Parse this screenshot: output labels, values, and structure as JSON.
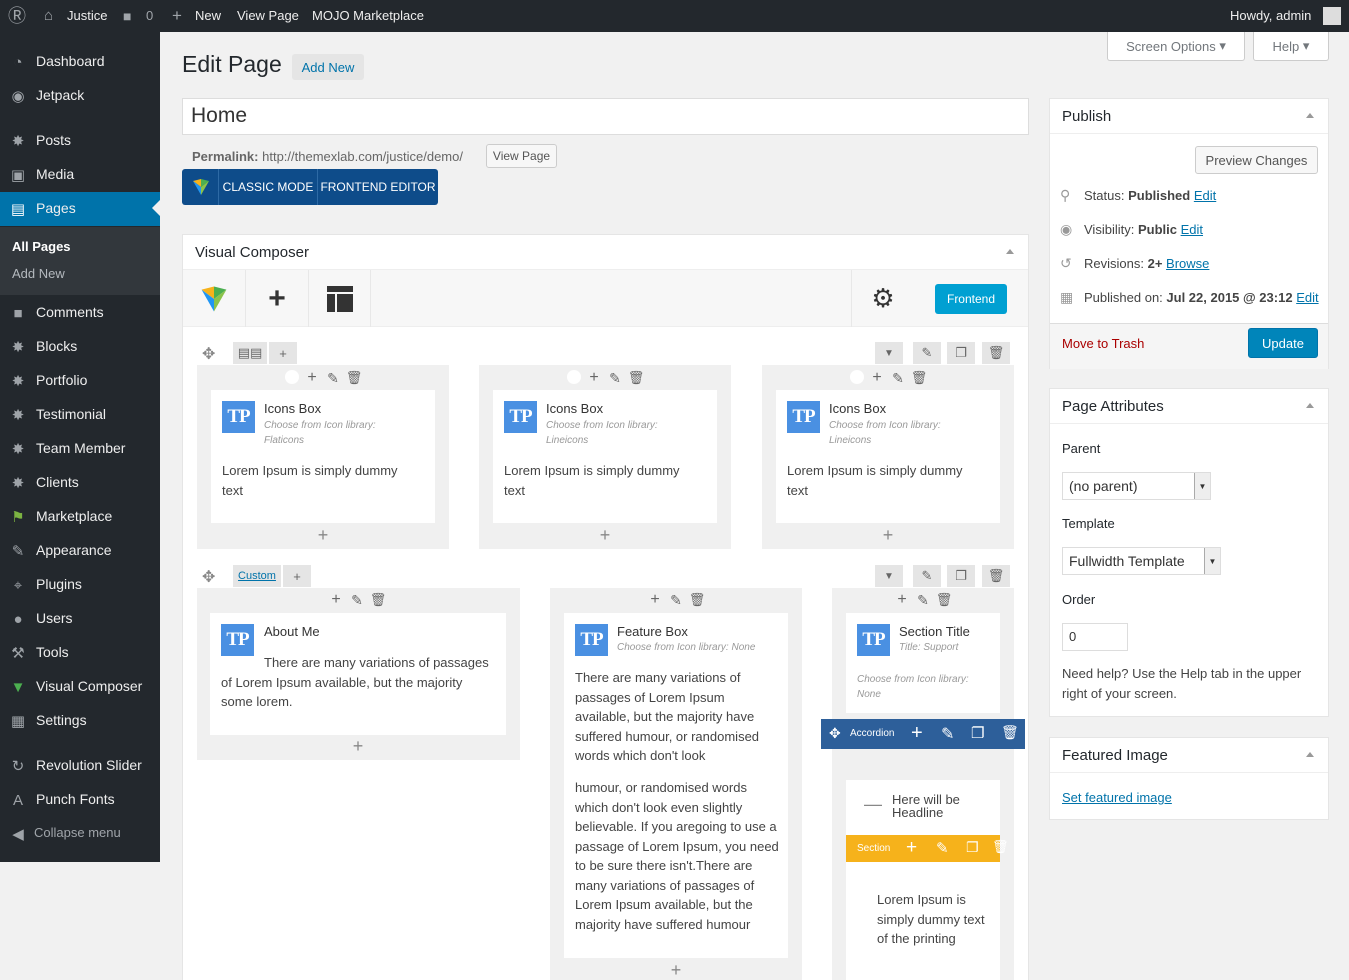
{
  "adminbar": {
    "site_name": "Justice",
    "comments_count": "0",
    "new_label": "New",
    "view_page": "View Page",
    "marketplace": "MOJO Marketplace",
    "howdy": "Howdy, admin"
  },
  "menu": {
    "items": [
      {
        "label": "Dashboard",
        "icon": "dashboard-icon"
      },
      {
        "label": "Jetpack",
        "icon": "jetpack-icon"
      },
      {
        "label": "Posts",
        "icon": "pin-icon"
      },
      {
        "label": "Media",
        "icon": "media-icon"
      },
      {
        "label": "Pages",
        "icon": "pages-icon"
      },
      {
        "label": "Comments",
        "icon": "comments-icon"
      },
      {
        "label": "Blocks",
        "icon": "pin-icon"
      },
      {
        "label": "Portfolio",
        "icon": "pin-icon"
      },
      {
        "label": "Testimonial",
        "icon": "pin-icon"
      },
      {
        "label": "Team Member",
        "icon": "pin-icon"
      },
      {
        "label": "Clients",
        "icon": "pin-icon"
      },
      {
        "label": "Marketplace",
        "icon": "marketplace-icon"
      },
      {
        "label": "Appearance",
        "icon": "brush-icon"
      },
      {
        "label": "Plugins",
        "icon": "plugin-icon"
      },
      {
        "label": "Users",
        "icon": "users-icon"
      },
      {
        "label": "Tools",
        "icon": "wrench-icon"
      },
      {
        "label": "Visual Composer",
        "icon": "vc-icon"
      },
      {
        "label": "Settings",
        "icon": "settings-icon"
      },
      {
        "label": "Revolution Slider",
        "icon": "refresh-icon"
      },
      {
        "label": "Punch Fonts",
        "icon": "font-icon"
      },
      {
        "label": "Collapse menu",
        "icon": "collapse-icon"
      }
    ],
    "submenu": [
      "All Pages",
      "Add New"
    ]
  },
  "screen_options": "Screen Options",
  "help": "Help",
  "page": {
    "heading": "Edit Page",
    "add_new": "Add New",
    "title_value": "Home",
    "permalink_label": "Permalink:",
    "permalink_url": "http://themexlab.com/justice/demo/",
    "view_page_btn": "View Page",
    "classic_mode": "CLASSIC MODE",
    "frontend_editor": "FRONTEND EDITOR"
  },
  "vc": {
    "title": "Visual Composer",
    "frontend_btn": "Frontend",
    "row2_custom": "Custom",
    "row1": [
      {
        "title": "Icons Box",
        "sub1": "Choose from Icon library:",
        "sub2": "Flaticons",
        "text": "Lorem Ipsum is simply dummy text"
      },
      {
        "title": "Icons Box",
        "sub1": "Choose from Icon library:",
        "sub2": "Lineicons",
        "text": "Lorem Ipsum is simply dummy text"
      },
      {
        "title": "Icons Box",
        "sub1": "Choose from Icon library:",
        "sub2": "Lineicons",
        "text": "Lorem Ipsum is simply dummy text"
      }
    ],
    "about": {
      "title": "About Me",
      "text": "There are many variations of passages of Lorem Ipsum available, but the majority some lorem."
    },
    "feature": {
      "title": "Feature Box",
      "sub": "Choose from Icon library: None",
      "text1": "There are many variations of passages of Lorem Ipsum available, but the majority have suffered humour, or randomised words which don't look",
      "text2": "humour, or randomised words which don't look even slightly believable. If you aregoing to use a passage of Lorem Ipsum, you need to be sure there isn't.There are many variations of passages of Lorem Ipsum available, but the majority have suffered humour"
    },
    "section_title": {
      "title": "Section Title",
      "sub1": "Title: Support",
      "sub2": "Choose from Icon library:",
      "sub3": "None"
    },
    "accordion_label": "Accordion",
    "headline": "Here will be Headline",
    "section_label": "Section",
    "section_text": "Lorem Ipsum is simply dummy text of the printing"
  },
  "publish": {
    "title": "Publish",
    "preview": "Preview Changes",
    "status_label": "Status:",
    "status_value": "Published",
    "visibility_label": "Visibility:",
    "visibility_value": "Public",
    "revisions_label": "Revisions:",
    "revisions_value": "2+",
    "browse": "Browse",
    "published_on_label": "Published on:",
    "published_on_value": "Jul 22, 2015 @ 23:12",
    "edit": "Edit",
    "trash": "Move to Trash",
    "update": "Update"
  },
  "attributes": {
    "title": "Page Attributes",
    "parent_label": "Parent",
    "parent_value": "(no parent)",
    "template_label": "Template",
    "template_value": "Fullwidth Template",
    "order_label": "Order",
    "order_value": "0",
    "help_text": "Need help? Use the Help tab in the upper right of your screen."
  },
  "featured": {
    "title": "Featured Image",
    "link": "Set featured image"
  },
  "colors": {
    "accent": "#0073aa",
    "menu_bg": "#23282d",
    "vc_blue": "#2d5f9a",
    "section_yellow": "#f6b21b",
    "frontend_btn": "#00a0d2"
  }
}
